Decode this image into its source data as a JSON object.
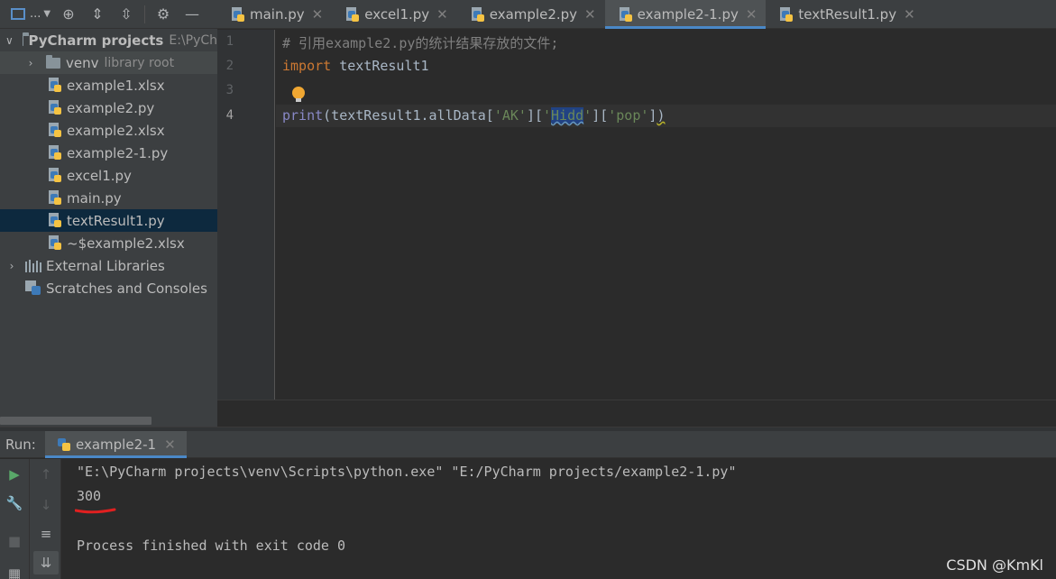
{
  "project_toolbar": {
    "view_label": "...",
    "icons": [
      "project-view-icon",
      "locate-icon",
      "expand-all-icon",
      "collapse-all-icon",
      "gear-icon",
      "minimize-icon"
    ]
  },
  "tree": {
    "root": {
      "label": "PyCharm projects",
      "path": "E:\\PyCh"
    },
    "venv": {
      "label": "venv",
      "note": "library root"
    },
    "files": [
      "example1.xlsx",
      "example2.py",
      "example2.xlsx",
      "example2-1.py",
      "excel1.py",
      "main.py",
      "textResult1.py",
      "~$example2.xlsx"
    ],
    "selected_file": "textResult1.py",
    "external_libraries": "External Libraries",
    "scratches": "Scratches and Consoles"
  },
  "editor": {
    "tabs": [
      "main.py",
      "excel1.py",
      "example2.py",
      "example2-1.py",
      "textResult1.py"
    ],
    "active_tab": "example2-1.py",
    "line_numbers": [
      "1",
      "2",
      "3",
      "4"
    ],
    "code": {
      "line1": "# 引用example2.py的统计结果存放的文件;",
      "line2_kw": "import",
      "line2_rest": " textResult1",
      "line4_builtin": "print",
      "line4_a": "(textResult1.allData[",
      "line4_s1": "'AK'",
      "line4_b": "][",
      "line4_q1": "'",
      "line4_sel": "Hidd",
      "line4_q2": "'",
      "line4_c": "][",
      "line4_s3": "'pop'",
      "line4_d": "]",
      "line4_e": ")"
    }
  },
  "run": {
    "label": "Run:",
    "tab": "example2-1",
    "console_lines": [
      "\"E:\\PyCharm projects\\venv\\Scripts\\python.exe\" \"E:/PyCharm projects/example2-1.py\"",
      "300",
      "",
      "Process finished with exit code 0"
    ],
    "side_icons": [
      "run-icon",
      "wrench-icon",
      "stop-icon",
      "up-arrow-icon",
      "down-arrow-icon",
      "soft-wrap-icon",
      "scroll-to-end-icon"
    ]
  },
  "watermark": "CSDN @KmKl",
  "colors": {
    "accent": "#4a88c7",
    "selection": "#0d293e",
    "keyword": "#cc7832",
    "string": "#6a8759",
    "annotation_red": "#e02020"
  }
}
